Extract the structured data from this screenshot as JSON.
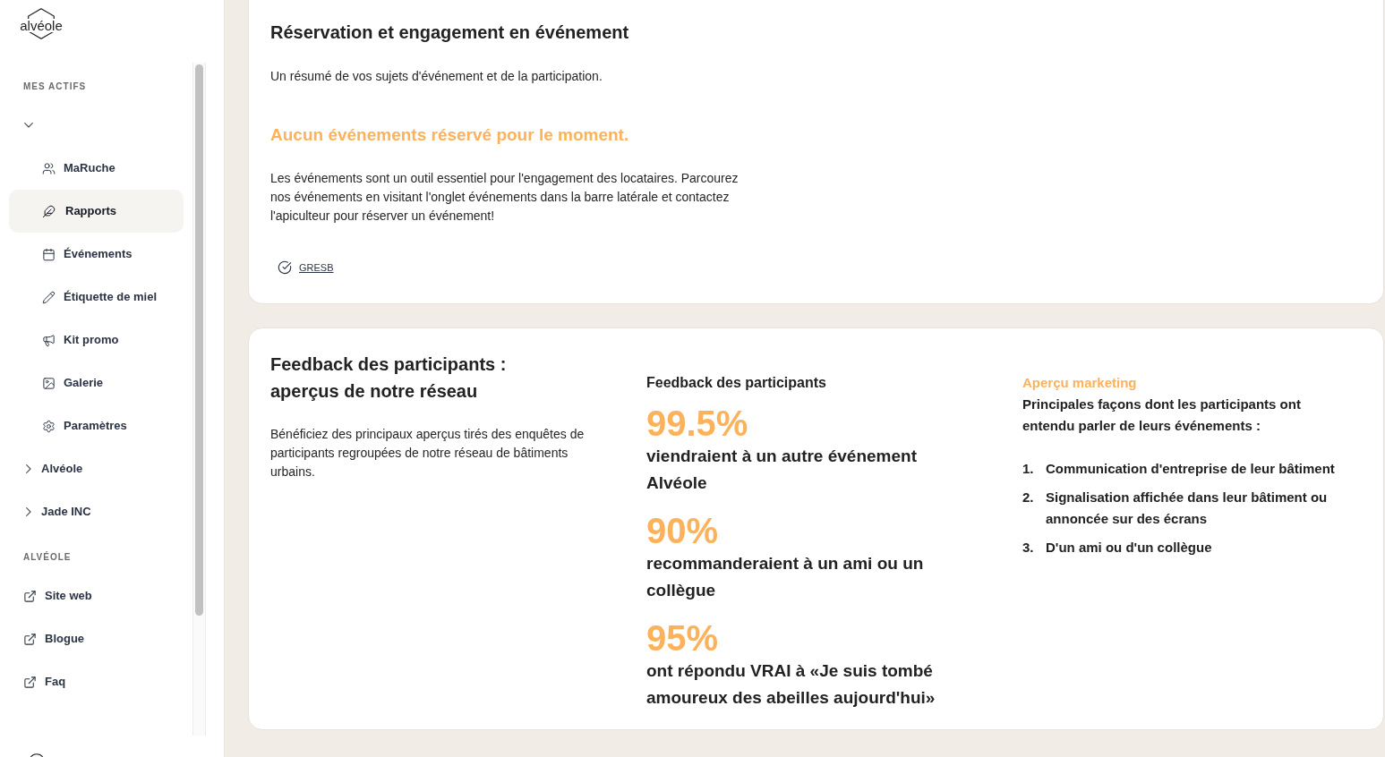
{
  "logo": "alvéole",
  "sidebar": {
    "sections": [
      {
        "heading": "MES ACTIFS",
        "groups": [
          {
            "expanded": true,
            "children": [
              {
                "label": "MaRuche",
                "selected": false
              },
              {
                "label": "Rapports",
                "selected": true
              },
              {
                "label": "Événements",
                "selected": false
              },
              {
                "label": "Étiquette de miel",
                "selected": false
              },
              {
                "label": "Kit promo",
                "selected": false
              },
              {
                "label": "Galerie",
                "selected": false
              },
              {
                "label": "Paramètres",
                "selected": false
              }
            ]
          },
          {
            "label": "Alvéole",
            "expanded": false
          },
          {
            "label": "Jade INC",
            "expanded": false
          }
        ]
      },
      {
        "heading": "ALVÉOLE",
        "links": [
          {
            "label": "Site web"
          },
          {
            "label": "Blogue"
          },
          {
            "label": "Faq"
          }
        ]
      }
    ]
  },
  "booking_card": {
    "title": "Réservation et engagement en événement",
    "subtitle": "Un résumé de vos sujets d'événement et de la participation.",
    "empty_message": "Aucun événements réservé pour le moment.",
    "description": "Les événements sont un outil essentiel pour l'engagement des locataires. Parcourez nos événements en visitant l'onglet événements dans la barre latérale et contactez l'apiculteur pour réserver un événement!",
    "links": [
      {
        "label": "GRESB"
      }
    ]
  },
  "feedback_card": {
    "title": "Feedback des participants :\naperçus de notre réseau",
    "description": "Bénéficiez des principaux aperçus tirés des enquêtes de participants regroupées de notre réseau de bâtiments urbains.",
    "stats": {
      "heading": "Feedback des participants",
      "items": [
        {
          "value": "99.5%",
          "caption": "viendraient à un autre événement Alvéole"
        },
        {
          "value": "90%",
          "caption": "recommanderaient à un ami ou un collègue"
        },
        {
          "value": "95%",
          "caption": "ont répondu VRAI à «Je suis tombé amoureux des abeilles aujourd'hui»"
        }
      ]
    },
    "marketing": {
      "eyebrow": "Aperçu marketing",
      "heading": "Principales façons dont les participants ont entendu parler de leurs événements :",
      "items": [
        {
          "number": "1.",
          "text": "Communication d'entreprise de leur bâtiment"
        },
        {
          "number": "2.",
          "text": "Signalisation affichée dans leur bâtiment ou annoncée sur des écrans"
        },
        {
          "number": "3.",
          "text": "D'un ami ou d'un collègue"
        }
      ]
    }
  }
}
